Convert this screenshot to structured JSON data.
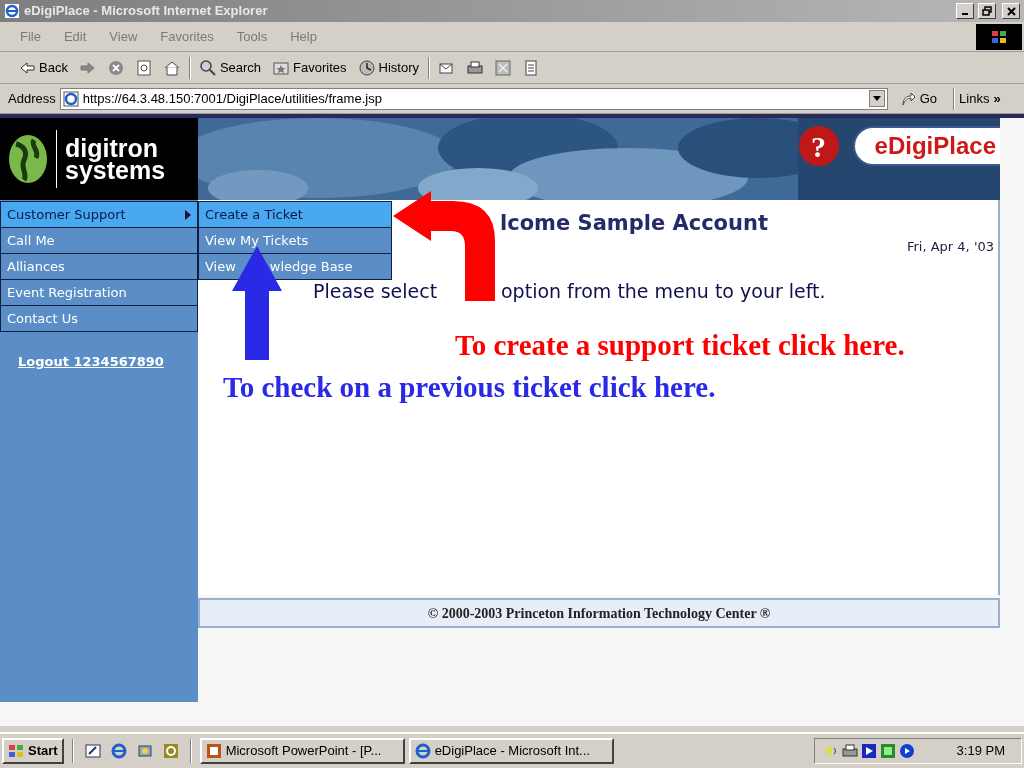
{
  "window": {
    "title": "eDigiPlace - Microsoft Internet Explorer"
  },
  "menu_bar": [
    "File",
    "Edit",
    "View",
    "Favorites",
    "Tools",
    "Help"
  ],
  "toolbar": [
    {
      "kind": "back",
      "label": "Back"
    },
    {
      "kind": "forward"
    },
    {
      "kind": "stop"
    },
    {
      "kind": "refresh"
    },
    {
      "kind": "home"
    },
    {
      "kind": "search",
      "label": "Search"
    },
    {
      "kind": "favorites",
      "label": "Favorites"
    },
    {
      "kind": "history",
      "label": "History"
    },
    {
      "kind": "mail"
    },
    {
      "kind": "print"
    },
    {
      "kind": "edit"
    },
    {
      "kind": "discuss"
    }
  ],
  "address_bar": {
    "label": "Address",
    "url": "https://64.3.48.150:7001/DigiPlace/utilities/frame.jsp",
    "go": "Go",
    "links": "Links",
    "more": "»"
  },
  "site": {
    "logo": [
      "digitron",
      "systems"
    ],
    "help_mark": "?",
    "brand": "eDigiPlace",
    "menu": [
      {
        "label": "Customer Support",
        "selected": true,
        "submenu": true
      },
      {
        "label": "Call Me",
        "selected": false,
        "submenu": false
      },
      {
        "label": "Alliances",
        "selected": false,
        "submenu": false
      },
      {
        "label": "Event Registration",
        "selected": false,
        "submenu": false
      },
      {
        "label": "Contact Us",
        "selected": false,
        "submenu": false
      }
    ],
    "submenu": [
      {
        "label": "Create a Ticket",
        "selected": true
      },
      {
        "label": "View My Tickets",
        "selected": false
      },
      {
        "label": "View",
        "label_after_gap": "wledge Base",
        "selected": false
      }
    ],
    "logout": "Logout 1234567890",
    "heading": "lcome Sample Account",
    "date": "Fri, Apr 4, '03",
    "instruction": [
      "Please select",
      "option from the menu to your left."
    ],
    "footer": "© 2000-2003 Princeton Information Technology Center ®"
  },
  "annotations": [
    {
      "text": "To create a support ticket click here.",
      "color": "#ff0000",
      "kind": "curved"
    },
    {
      "text": "To check on a previous ticket click here.",
      "color": "#2a2ae6",
      "kind": "straight"
    }
  ],
  "taskbar": {
    "start": "Start",
    "quick_launch": [
      {
        "kind": "desktop"
      },
      {
        "kind": "browser"
      },
      {
        "kind": "channels"
      },
      {
        "kind": "media"
      }
    ],
    "tasks": [
      {
        "kind": "powerpoint",
        "label": "Microsoft PowerPoint - [P..."
      },
      {
        "kind": "browser",
        "label": "eDigiPlace - Microsoft Int..."
      }
    ],
    "clock": "3:19 PM"
  }
}
